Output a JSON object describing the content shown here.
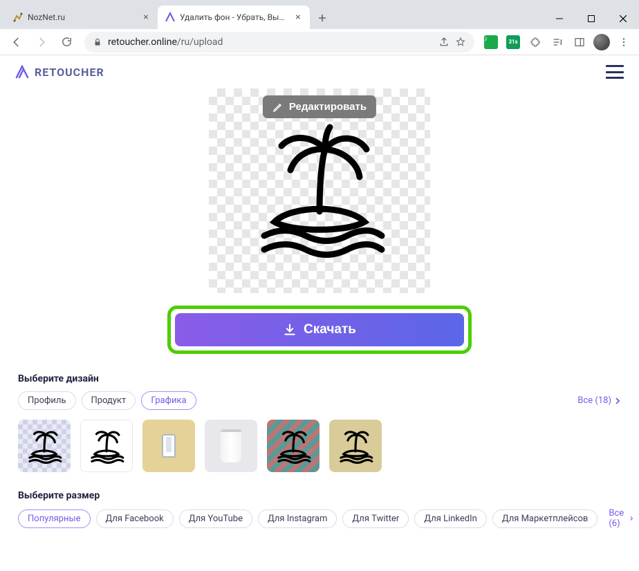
{
  "browser": {
    "tabs": [
      {
        "title": "NozNet.ru",
        "active": false
      },
      {
        "title": "Удалить фон - Убрать, Вырезать",
        "active": true
      }
    ],
    "url_domain": "retoucher.online",
    "url_path": "/ru/upload"
  },
  "header": {
    "brand": "RETOUCHER"
  },
  "edit_label": "Редактировать",
  "download_label": "Скачать",
  "sections": {
    "design": {
      "title": "Выберите дизайн",
      "chips": [
        "Профиль",
        "Продукт",
        "Графика"
      ],
      "active_index": 2,
      "all_label": "Все (18)"
    },
    "size": {
      "title": "Выберите размер",
      "chips": [
        "Популярные",
        "Для Facebook",
        "Для YouTube",
        "Для Instagram",
        "Для Twitter",
        "Для LinkedIn",
        "Для Маркетплейсов"
      ],
      "active_index": 0,
      "all_label": "Все (6)"
    }
  }
}
